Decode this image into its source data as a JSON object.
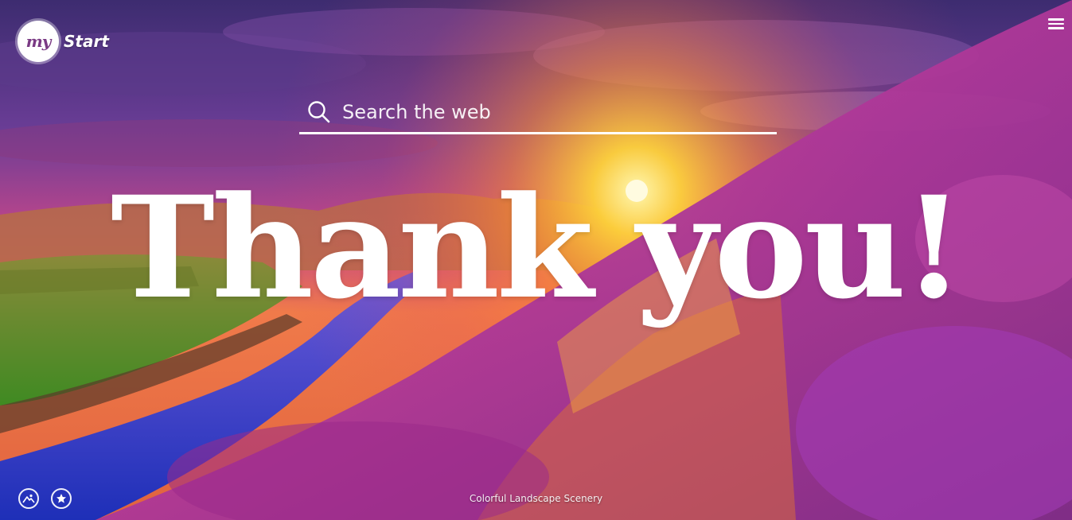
{
  "brand": {
    "badge_text": "my",
    "name": "Start"
  },
  "search": {
    "placeholder": "Search the web"
  },
  "headline": "Thank you!",
  "footer": {
    "caption": "Colorful Landscape Scenery",
    "icons": [
      "landscape-icon",
      "star-icon"
    ]
  },
  "colors": {
    "sky_top": "#3b2d6e",
    "sky_mid": "#b23f8f",
    "sun": "#ffd23a",
    "heather": "#b23aa8",
    "grass": "#5aa02a",
    "river": "#2b3fd0"
  }
}
